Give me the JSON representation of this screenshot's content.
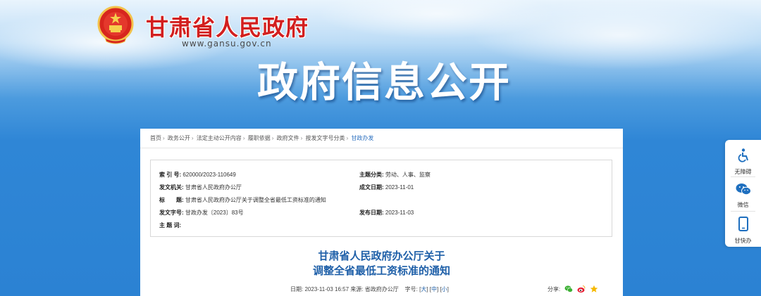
{
  "header": {
    "site_title": "甘肃省人民政府",
    "site_url": "www.gansu.gov.cn",
    "banner_title": "政府信息公开"
  },
  "breadcrumb": [
    "首页",
    "政务公开",
    "法定主动公开内容",
    "履职依据",
    "政府文件",
    "按发文字号分类",
    "甘政办发"
  ],
  "meta": {
    "index_label": "索 引 号:",
    "index_value": "620000/2023-110649",
    "topic_label": "主题分类:",
    "topic_value": "劳动、人事、监察",
    "issuer_label": "发文机关:",
    "issuer_value": "甘肃省人民政府办公厅",
    "created_label": "成文日期:",
    "created_value": "2023-11-01",
    "title_label": "标　　题:",
    "title_value": "甘肃省人民政府办公厅关于调整全省最低工资标准的通知",
    "docno_label": "发文字号:",
    "docno_value": "甘政办发〔2023〕83号",
    "published_label": "发布日期:",
    "published_value": "2023-11-03",
    "keywords_label": "主 题 词:",
    "keywords_value": ""
  },
  "document": {
    "title_line1": "甘肃省人民政府办公厅关于",
    "title_line2": "调整全省最低工资标准的通知",
    "date_label": "日期:",
    "date_value": "2023-11-03 16:57",
    "source_label": "来源:",
    "source_value": "省政府办公厅",
    "fontsize_label": "字号:",
    "font_large": "大",
    "font_medium": "中",
    "font_small": "小",
    "share_label": "分享:"
  },
  "sidebar": {
    "accessibility": "无障碍",
    "wechat": "微信",
    "app": "甘快办"
  },
  "colors": {
    "brand_red": "#d21f1f",
    "link_blue": "#1e5fa8",
    "sky_blue": "#2f86d6"
  },
  "icons": [
    "national-emblem-icon",
    "wheelchair-icon",
    "wechat-icon",
    "mobile-icon",
    "wechat-share-icon",
    "weibo-share-icon",
    "favorite-star-icon"
  ]
}
